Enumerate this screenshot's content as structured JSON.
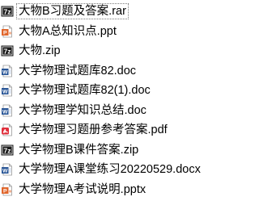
{
  "files": [
    {
      "name": "大物B习题及答案.rar",
      "type": "archive",
      "icon": "7zip-archive-icon",
      "selected": true
    },
    {
      "name": "大物A总知识点.ppt",
      "type": "presentation",
      "icon": "powerpoint-file-icon",
      "selected": false
    },
    {
      "name": "大物.zip",
      "type": "archive",
      "icon": "7zip-archive-icon",
      "selected": false
    },
    {
      "name": "大学物理试题库82.doc",
      "type": "document",
      "icon": "word-file-icon",
      "selected": false
    },
    {
      "name": "大学物理试题库82(1).doc",
      "type": "document",
      "icon": "word-file-icon",
      "selected": false
    },
    {
      "name": "大学物理学知识总结.doc",
      "type": "document",
      "icon": "word-file-icon",
      "selected": false
    },
    {
      "name": "大学物理习题册参考答案.pdf",
      "type": "pdf",
      "icon": "pdf-file-icon",
      "selected": false
    },
    {
      "name": "大学物理B课件答案.zip",
      "type": "archive",
      "icon": "7zip-archive-icon",
      "selected": false
    },
    {
      "name": "大学物理A课堂练习20220529.docx",
      "type": "document",
      "icon": "word-file-icon",
      "selected": false
    },
    {
      "name": "大学物理A考试说明.pptx",
      "type": "presentation",
      "icon": "powerpoint-file-icon",
      "selected": false
    }
  ],
  "colors": {
    "archive_bg": "#1a1a1a",
    "word_blue": "#2b5797",
    "ppt_orange": "#e0662c",
    "pdf_red": "#e02f3c"
  },
  "icon_glyphs": {
    "archive": "7z",
    "document": "W",
    "presentation": "P"
  }
}
